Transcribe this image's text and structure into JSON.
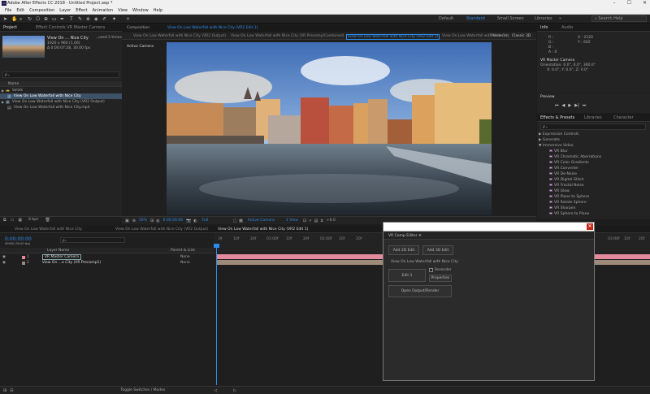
{
  "window": {
    "title": "Adobe After Effects CC 2018 - Untitled Project.aep *",
    "app_icon": "Ae",
    "controls": [
      "–",
      "☐",
      "✕"
    ]
  },
  "menu": [
    "File",
    "Edit",
    "Composition",
    "Layer",
    "Effect",
    "Animation",
    "View",
    "Window",
    "Help"
  ],
  "workspaces": {
    "items": [
      "Default",
      "Standard",
      "Small Screen",
      "Libraries"
    ],
    "active": "Standard",
    "search_placeholder": "Search Help"
  },
  "effect_controls_tab": "Effect Controls  VR Master Camera",
  "project": {
    "tab": "Project",
    "item_name": "View On ... Nice City",
    "used_count": ", used 2 times",
    "item_meta_1": "1920 x 960 (1.00)",
    "item_meta_2": "Δ 0:00:07:28, 30.00 fps",
    "search_placeholder": "",
    "col_name": "Name",
    "rows": [
      {
        "name": "Solids",
        "kind": "folder"
      },
      {
        "name": "View On Low Waterfall with Nice City",
        "kind": "comp",
        "selected": true
      },
      {
        "name": "View On Low Waterfall with Nice City (VR2 Output)",
        "kind": "comp"
      },
      {
        "name": "View On Low Waterfall with Nice City.mp4",
        "kind": "footage"
      }
    ],
    "bpc": "8 bpc"
  },
  "composition": {
    "header": "Composition",
    "header_name": "View On Low Waterfall with Nice City (VR2 Edit 1)",
    "tabs": [
      "View On Low Waterfall with Nice City (VR2 Output)",
      "View On Low Waterfall with Nice City (VR Precomp/Combined)",
      "View On Low Waterfall with Nice City (VR2 Edit 1)",
      "View On Low Waterfall with Nice City"
    ],
    "active_tab": "View On Low Waterfall with Nice City (VR2 Edit 1)",
    "renderer_label": "Renderer:",
    "renderer_value": "Classic 3D",
    "view_label": "Active Camera",
    "footer": {
      "zoom": "50%",
      "timecode": "0:00:00:00",
      "resolution": "Full",
      "camera": "Active Camera",
      "views": "1 View",
      "offset": "+0.0"
    }
  },
  "info": {
    "tab": "Info",
    "tab2": "Audio",
    "r": "R :",
    "g": "G :",
    "b": "B :",
    "a": "A : 0",
    "x": "X : 2120",
    "y": "Y : 602",
    "camera_name": "VR Master Camera",
    "camera_meta": "Orientation: 0.0°, 0.0°, 360.0°",
    "camera_pos": "X: 0.0°, Y: 0.0°, Z: 0.0°"
  },
  "preview": {
    "tab": "Preview"
  },
  "effects": {
    "tab": "Effects & Presets",
    "tab2": "Libraries",
    "tab3": "Character",
    "search_placeholder": "ρ⌄",
    "groups": [
      "Expression Controls",
      "Generate",
      "Immersive Video"
    ],
    "items": [
      "VR Blur",
      "VR Chromatic Aberrations",
      "VR Color Gradients",
      "VR Converter",
      "VR De-Noise",
      "VR Digital Glitch",
      "VR Fractal Noise",
      "VR Glow",
      "VR Plane to Sphere",
      "VR Rotate Sphere",
      "VR Sharpen",
      "VR Sphere to Plane"
    ]
  },
  "timeline": {
    "tabs": [
      "View On Low Waterfall with Nice City",
      "View On Low Waterfall with Nice City (VR2 Output)",
      "View On Low Waterfall with Nice City (VR2 Edit 1)"
    ],
    "active_tab": "View On Low Waterfall with Nice City (VR2 Edit 1)",
    "timecode": "0:00:00:00",
    "fps_meta": "00000 (30.00 fps)",
    "col_layer_name": "Layer Name",
    "col_parent": "Parent & Link",
    "layers": [
      {
        "num": "1",
        "name": "VR Master Camera",
        "parent": "None",
        "color": "#e48a9d"
      },
      {
        "num": "2",
        "name": "View On ...e City (VR Precomp1)",
        "parent": "None",
        "color": "#9e8a78"
      }
    ],
    "ruler": [
      "0f",
      "10f",
      "20f",
      "01:00f",
      "10f",
      "20f",
      "02:00f",
      "10f",
      "20f",
      "03:00f",
      "10f",
      "20f"
    ],
    "toggle_label": "Toggle Switches / Modes"
  },
  "dialog": {
    "title": "VR Comp Editor",
    "close": "✕",
    "panel_tab": "VR Comp Editor  ≡",
    "add_2d": "Add 2D Edit",
    "add_3d": "Add 3D Edit",
    "comp_name": "View On Low Waterfall with Nice City",
    "edit_btn": "Edit 1",
    "rerender_label": "Rerender",
    "properties_btn": "Properties",
    "open_output": "Open Output/Render"
  }
}
